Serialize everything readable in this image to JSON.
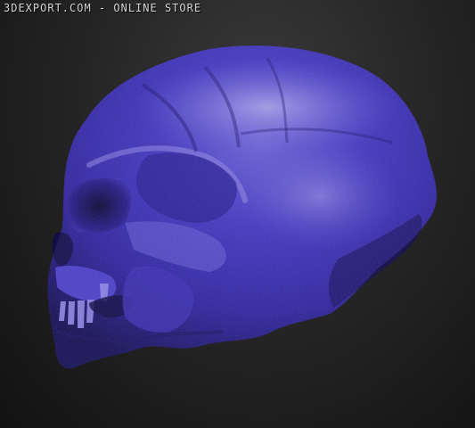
{
  "watermark": "3DEXPORT.COM - ONLINE STORE",
  "subject_icon": "skull-sculpt",
  "colors": {
    "background_light": "#3a3a3a",
    "background_dark": "#121212",
    "skull_base": "#3b2fb0",
    "skull_highlight": "#8f87e6",
    "skull_shadow": "#150f55"
  }
}
